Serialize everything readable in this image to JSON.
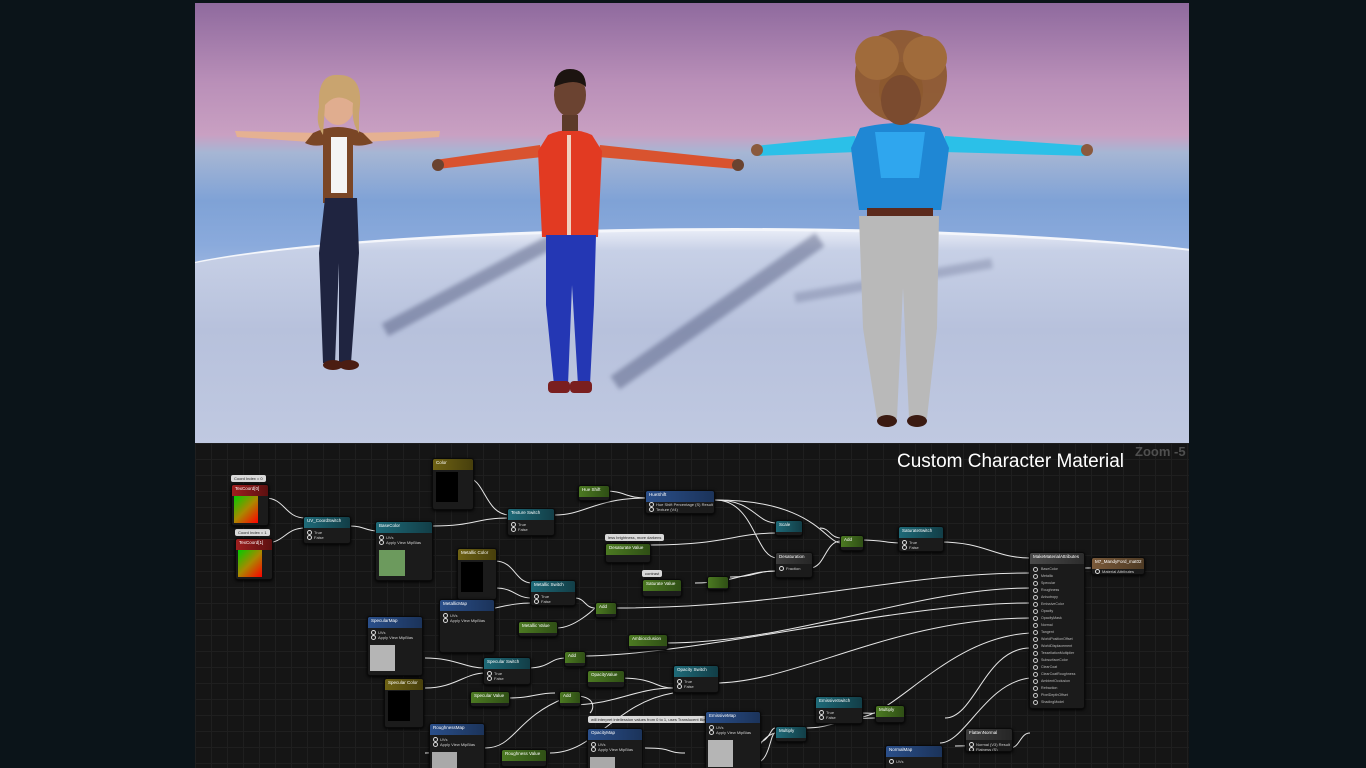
{
  "viewport": {
    "characters": [
      "character-blonde-woman",
      "character-man-red-jacket",
      "character-curly-hair-woman"
    ]
  },
  "graph": {
    "title": "Custom Character Material",
    "zoom": "Zoom -5",
    "comments": {
      "coord_index_0": "Coord Index = 0",
      "coord_index_1": "Coord Index = 1",
      "less_brightness": "less brightness, more darkens",
      "contrast": "contrast",
      "translucent_note": "will interpret intellession values from 0 to 1, uses Translucent Blend"
    },
    "nodes": {
      "texcoord0": "TexCoord[0]",
      "texcoord1": "TexCoord[1]",
      "uv_coord_switch": "UV_CoordSwitch",
      "base_color": "BaseColor",
      "color": "Color",
      "texture_switch": "Texture Switch",
      "hue_shift": "Hue Shift",
      "hue_shift_fn": "HueShift",
      "desaturate_value": "Desaturate Value",
      "scale": "Scale",
      "add_1": "Add",
      "saturate_switch": "SaturateSwitch",
      "desaturation": "Desaturation",
      "saturate_value": "Saturate Value",
      "metallic_color": "Metallic Color",
      "metallic_switch": "Metallic Switch",
      "metallic_map": "MetallicMap",
      "add_2": "Add",
      "metallic_value": "Metallic Value",
      "specular_map": "SpecularMap",
      "specular_switch": "Specular Switch",
      "add_3": "Add",
      "specular_color": "Specular Color",
      "specular_value": "Specular Value",
      "opacity_value": "OpacityValue",
      "opacity_switch": "Opacity Switch",
      "add_4": "Add",
      "ambiocclusion": "Ambiocclusion",
      "roughness_map": "RoughnessMap",
      "roughness_value": "Roughness Value",
      "opacity_map": "OpacityMap",
      "emissive_map": "EmissiveMap",
      "emissive_switch": "EmissiveSwitch",
      "multiply_1": "Multiply",
      "multiply_2": "Multiply",
      "normal_map": "NormalMap",
      "flatten_normal": "FlattenNormal",
      "make_material_attributes": "MakeMaterialAttributes",
      "output": "M7_MandyFord_mat02",
      "output_pin": "Material Attributes"
    },
    "attribute_pins": [
      "BaseColor",
      "Metallic",
      "Specular",
      "Roughness",
      "Anisotropy",
      "EmissiveColor",
      "Opacity",
      "OpacityMask",
      "Normal",
      "Tangent",
      "WorldPositionOffset",
      "WorldDisplacement",
      "TessellationMultiplier",
      "SubsurfaceColor",
      "ClearCoat",
      "ClearCoatRoughness",
      "AmbientOcclusion",
      "Refraction",
      "PixelDepthOffset",
      "ShadingModel"
    ],
    "pin_labels": {
      "uvs": "UVs",
      "apply_view_mip_bias": "Apply View MipBias",
      "true": "True",
      "false": "False",
      "texture": "Texture (V4)",
      "hue_shift_percentage": "Hue Shift Percentage (S)  Result",
      "fraction": "Fraction",
      "normal_in": "Normal (V3)  Result",
      "flatness": "Flatness (S)"
    }
  }
}
